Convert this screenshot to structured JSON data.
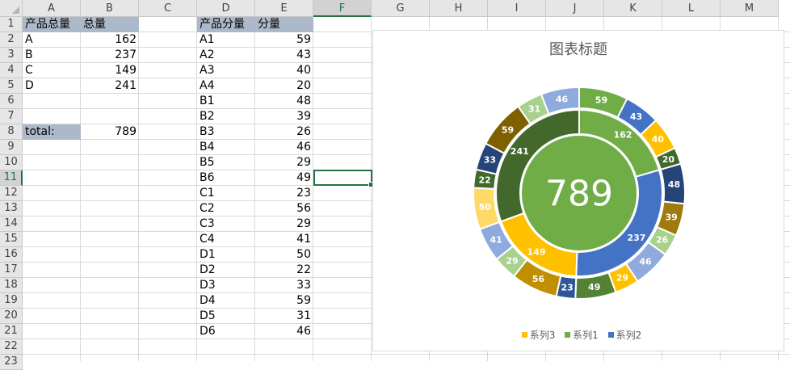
{
  "sheet": {
    "columns": [
      "A",
      "B",
      "C",
      "D",
      "E",
      "F",
      "G",
      "H",
      "I",
      "J",
      "K",
      "L",
      "M"
    ],
    "rows": [
      "1",
      "2",
      "3",
      "4",
      "5",
      "6",
      "7",
      "8",
      "9",
      "10",
      "11",
      "12",
      "13",
      "14",
      "15",
      "16",
      "17",
      "18",
      "19",
      "20",
      "21",
      "22",
      "23"
    ],
    "selected_column": "F",
    "selected_row": "11",
    "header_left": [
      "产品总量",
      "总量"
    ],
    "totals": [
      {
        "name": "A",
        "value": "162"
      },
      {
        "name": "B",
        "value": "237"
      },
      {
        "name": "C",
        "value": "149"
      },
      {
        "name": "D",
        "value": "241"
      }
    ],
    "total_label": "total:",
    "total_value": "789",
    "header_right": [
      "产品分量",
      "分量"
    ],
    "parts": [
      {
        "name": "A1",
        "value": "59"
      },
      {
        "name": "A2",
        "value": "43"
      },
      {
        "name": "A3",
        "value": "40"
      },
      {
        "name": "A4",
        "value": "20"
      },
      {
        "name": "B1",
        "value": "48"
      },
      {
        "name": "B2",
        "value": "39"
      },
      {
        "name": "B3",
        "value": "26"
      },
      {
        "name": "B4",
        "value": "46"
      },
      {
        "name": "B5",
        "value": "29"
      },
      {
        "name": "B6",
        "value": "49"
      },
      {
        "name": "C1",
        "value": "23"
      },
      {
        "name": "C2",
        "value": "56"
      },
      {
        "name": "C3",
        "value": "29"
      },
      {
        "name": "C4",
        "value": "41"
      },
      {
        "name": "D1",
        "value": "50"
      },
      {
        "name": "D2",
        "value": "22"
      },
      {
        "name": "D3",
        "value": "33"
      },
      {
        "name": "D4",
        "value": "59"
      },
      {
        "name": "D5",
        "value": "31"
      },
      {
        "name": "D6",
        "value": "46"
      }
    ]
  },
  "chart_data": {
    "type": "pie",
    "title": "图表标题",
    "center_label": "789",
    "legend": [
      "系列3",
      "系列1",
      "系列2"
    ],
    "legend_colors": [
      "#ffc000",
      "#70ad47",
      "#4472c4"
    ],
    "legend_position": "bottom",
    "series": [
      {
        "name": "系列3",
        "values": [
          789
        ],
        "colors": [
          "#70ad47"
        ]
      },
      {
        "name": "系列1",
        "categories": [
          "A",
          "B",
          "C",
          "D"
        ],
        "values": [
          162,
          237,
          149,
          241
        ],
        "colors": [
          "#70ad47",
          "#4472c4",
          "#ffc000",
          "#43682b"
        ]
      },
      {
        "name": "系列2",
        "categories": [
          "A1",
          "A2",
          "A3",
          "A4",
          "B1",
          "B2",
          "B3",
          "B4",
          "B5",
          "B6",
          "C1",
          "C2",
          "C3",
          "C4",
          "D1",
          "D2",
          "D3",
          "D4",
          "D5",
          "D6"
        ],
        "values": [
          59,
          43,
          40,
          20,
          48,
          39,
          26,
          46,
          29,
          49,
          23,
          56,
          29,
          41,
          50,
          22,
          33,
          59,
          31,
          46
        ],
        "colors": [
          "#70ad47",
          "#4472c4",
          "#ffc000",
          "#43682b",
          "#264478",
          "#9e7b0e",
          "#a9d18e",
          "#8faadc",
          "#ffc000",
          "#548235",
          "#2f5597",
          "#bf8f00",
          "#a9d18e",
          "#8faadc",
          "#ffd966",
          "#43682b",
          "#264478",
          "#7f6000",
          "#a9d18e",
          "#8faadc"
        ]
      }
    ]
  }
}
